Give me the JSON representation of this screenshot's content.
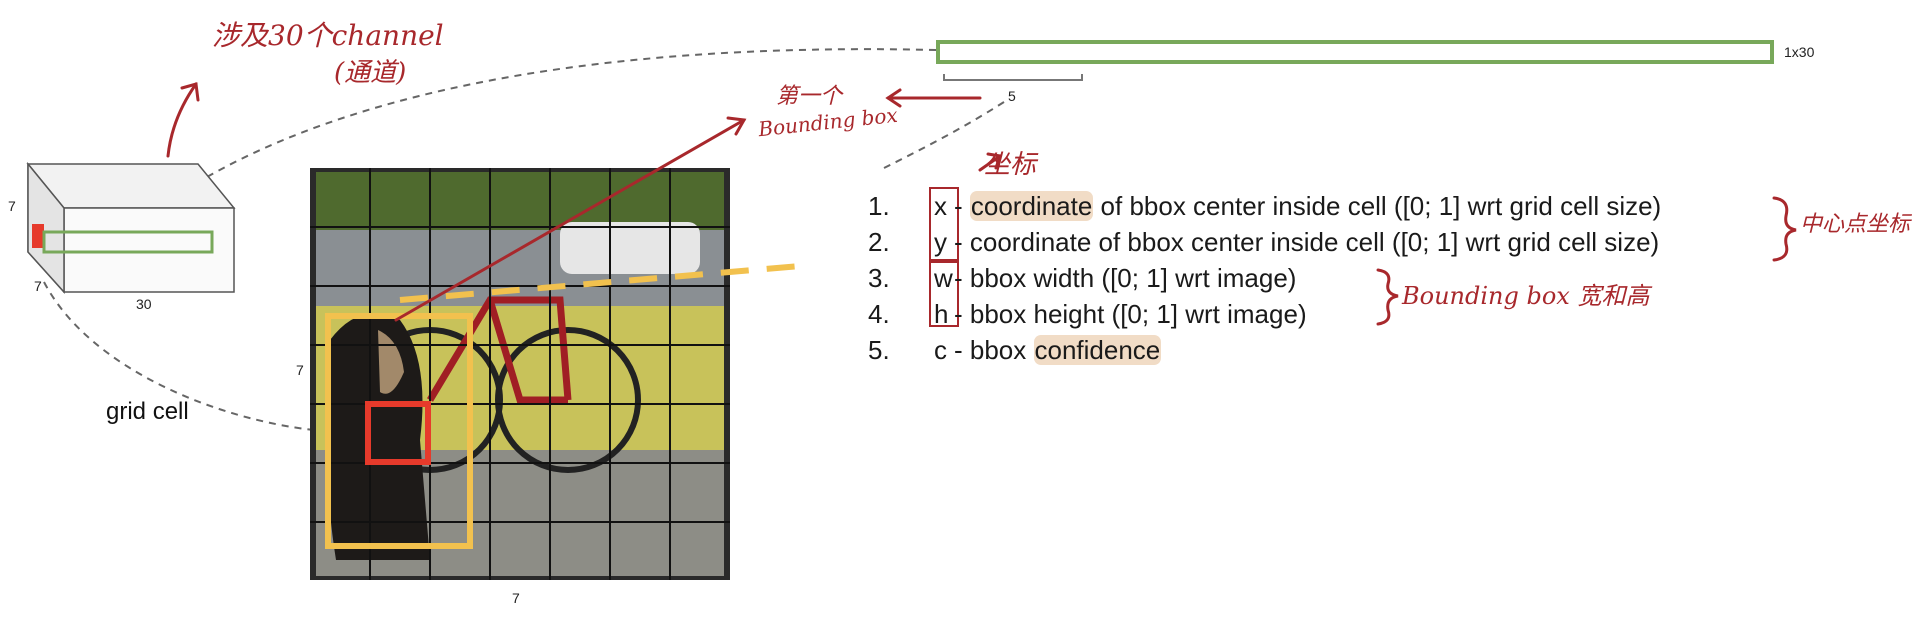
{
  "annotations": {
    "channels_line1": "涉及30个channel",
    "channels_line2": "(通道)",
    "first_box_line1": "第一个",
    "first_box_line2": "Bounding box",
    "coordinate_zh": "坐标",
    "center_coord_zh": "中心点坐标",
    "bbox_wh_zh": "Bounding box 宽和高"
  },
  "labels": {
    "vector_size": "1x30",
    "bracket_count": "5",
    "cube_height": "7",
    "cube_depth": "7",
    "cube_width": "30",
    "image_left": "7",
    "image_bottom": "7",
    "grid_cell": "grid cell"
  },
  "list": [
    {
      "num": "1.",
      "var": "x",
      "pre": " - ",
      "hl": "coordinate",
      "post": " of bbox center inside cell ([0; 1] wrt grid cell size)"
    },
    {
      "num": "2.",
      "var": "y",
      "pre": " - coordinate of bbox center inside cell ([0; 1] wrt grid cell size)",
      "hl": "",
      "post": ""
    },
    {
      "num": "3.",
      "var": "w",
      "pre": " - bbox width ([0; 1] wrt image)",
      "hl": "",
      "post": ""
    },
    {
      "num": "4.",
      "var": "h",
      "pre": " - bbox height ([0; 1] wrt image)",
      "hl": "",
      "post": ""
    },
    {
      "num": "5.",
      "var": "c",
      "pre": " - bbox ",
      "hl": "confidence",
      "post": ""
    }
  ],
  "colors": {
    "annotation_red": "#a8282c",
    "vector_green": "#78a85a",
    "box_yellow": "#f2c14e",
    "cell_red": "#e63a2b",
    "highlight": "#f1dcc6"
  }
}
